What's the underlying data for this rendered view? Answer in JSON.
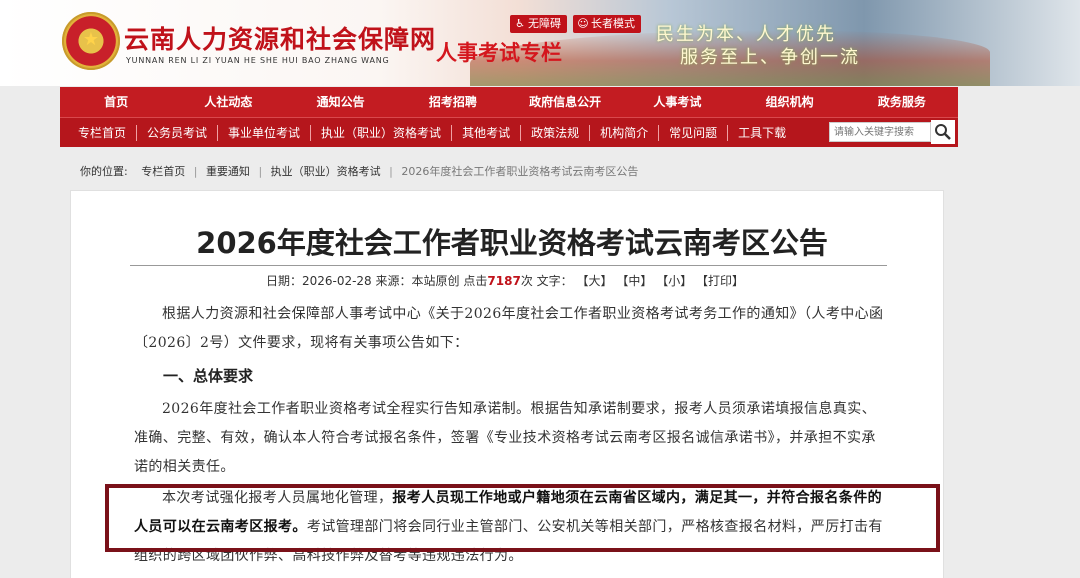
{
  "header": {
    "site_title": "云南人力资源和社会保障网",
    "site_title_en": "YUNNAN REN LI ZI YUAN HE SHE HUI BAO ZHANG WANG",
    "column_title": "人事考试专栏",
    "accessibility_label": "无障碍",
    "elder_mode_label": "长者模式",
    "slogan_line1": "民生为本、人才优先",
    "slogan_line2": "服务至上、争创一流"
  },
  "nav_main": [
    "首页",
    "人社动态",
    "通知公告",
    "招考招聘",
    "政府信息公开",
    "人事考试",
    "组织机构",
    "政务服务"
  ],
  "nav_sub": [
    "专栏首页",
    "公务员考试",
    "事业单位考试",
    "执业（职业）资格考试",
    "其他考试",
    "政策法规",
    "机构简介",
    "常见问题",
    "工具下载"
  ],
  "search": {
    "placeholder": "请输入关键字搜索"
  },
  "breadcrumb": {
    "prefix": "你的位置:",
    "items": [
      "专栏首页",
      "重要通知",
      "执业（职业）资格考试",
      "2026年度社会工作者职业资格考试云南考区公告"
    ]
  },
  "article": {
    "title": "2026年度社会工作者职业资格考试云南考区公告",
    "meta": {
      "date_label": "日期：",
      "date": "2026-02-28",
      "source_label": "来源：",
      "source": "本站原创",
      "hits_label": "点击",
      "hits": "7187",
      "hits_unit": "次",
      "font_label": "文字：",
      "font_large": "【大】",
      "font_medium": "【中】",
      "font_small": "【小】",
      "print": "【打印】"
    },
    "intro": "根据人力资源和社会保障部人事考试中心《关于2026年度社会工作者职业资格考试考务工作的通知》（人考中心函〔2026〕2号）文件要求，现将有关事项公告如下：",
    "section1_heading": "一、总体要求",
    "para1": "2026年度社会工作者职业资格考试全程实行告知承诺制。根据告知承诺制要求，报考人员须承诺填报信息真实、准确、完整、有效，确认本人符合考试报名条件，签署《专业技术资格考试云南考区报名诚信承诺书》，并承担不实承诺的相关责任。",
    "para2_normal_a": "本次考试强化报考人员属地化管理，",
    "para2_bold": "报考人员现工作地或户籍地须在云南省区域内，满足其一，并符合报名条件的人员可以在云南考区报考。",
    "para2_normal_b": "考试管理部门将会同行业主管部门、公安机关等相关部门，严格核查报名材料，严厉打击有组织的跨区域团伙作弊、高科技作弊及替考等违规违法行为。"
  },
  "colors": {
    "brand_red": "#c31c22",
    "highlight_border": "#7a1119"
  }
}
